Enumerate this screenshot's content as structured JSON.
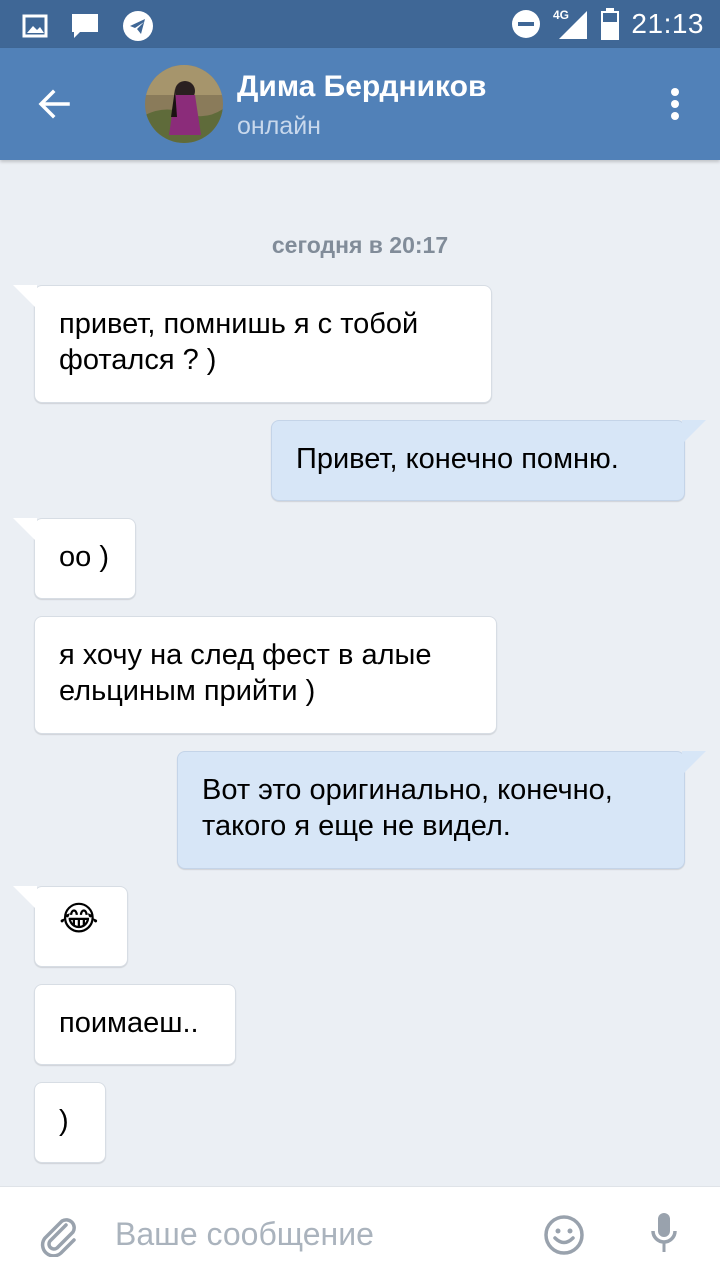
{
  "status_bar": {
    "time": "21:13",
    "network": "4G",
    "icons": [
      "image-icon",
      "message-icon",
      "telegram-icon",
      "do-not-disturb-icon",
      "signal-icon",
      "battery-icon"
    ]
  },
  "header": {
    "contact_name": "Дима Бердников",
    "status": "онлайн",
    "icons": [
      "back-arrow-icon",
      "avatar",
      "more-vert-icon"
    ]
  },
  "chat": {
    "date_separator": "сегодня в 20:17",
    "messages": [
      {
        "direction": "incoming",
        "text": "привет, помнишь я с тобой фотался ? )"
      },
      {
        "direction": "outgoing",
        "text": "Привет, конечно помню."
      },
      {
        "direction": "incoming",
        "text": "оо )"
      },
      {
        "direction": "incoming",
        "text": "я хочу на след фест в алые ельциным прийти )"
      },
      {
        "direction": "outgoing",
        "text": "Вот это оригинально, конечно, такого я еще не видел."
      },
      {
        "direction": "incoming",
        "text": "😂"
      },
      {
        "direction": "incoming",
        "text": "поимаеш.."
      },
      {
        "direction": "incoming",
        "text": ")"
      }
    ]
  },
  "composer": {
    "placeholder": "Ваше сообщение",
    "value": "",
    "icons": [
      "attach-icon",
      "emoji-icon",
      "mic-icon"
    ]
  },
  "colors": {
    "status_bar": "#3f6796",
    "header": "#5181b8",
    "background": "#ebeff4",
    "incoming_bubble": "#ffffff",
    "outgoing_bubble": "#d7e6f7"
  }
}
